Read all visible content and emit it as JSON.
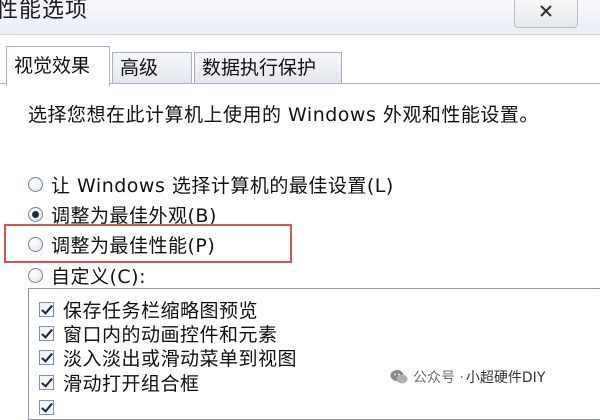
{
  "window": {
    "title": "性能选项",
    "close_icon": "close-icon"
  },
  "tabs": [
    {
      "label": "视觉效果",
      "active": true
    },
    {
      "label": "高级",
      "active": false
    },
    {
      "label": "数据执行保护",
      "active": false
    }
  ],
  "visual_effects": {
    "description": "选择您想在此计算机上使用的 Windows 外观和性能设置。",
    "options": [
      {
        "label": "让 Windows 选择计算机的最佳设置(L)",
        "checked": false
      },
      {
        "label": "调整为最佳外观(B)",
        "checked": true
      },
      {
        "label": "调整为最佳性能(P)",
        "checked": false,
        "highlighted": true
      },
      {
        "label": "自定义(C):",
        "checked": false
      }
    ],
    "effects_list": [
      {
        "label": "保存任务栏缩略图预览",
        "checked": true
      },
      {
        "label": "窗口内的动画控件和元素",
        "checked": true
      },
      {
        "label": "淡入淡出或滑动菜单到视图",
        "checked": true
      },
      {
        "label": "滑动打开组合框",
        "checked": true
      },
      {
        "label": "",
        "checked": true
      }
    ]
  },
  "watermark": {
    "icon": "wechat-icon",
    "prefix": "公众号 ·",
    "name": "小超硬件DIY"
  },
  "colors": {
    "highlight_border": "#d9534f"
  }
}
